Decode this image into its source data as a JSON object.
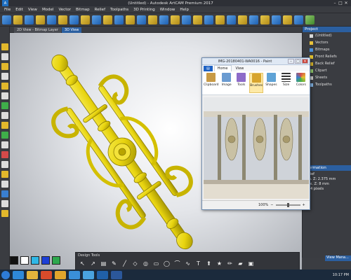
{
  "window": {
    "title": "(Untitled) - Autodesk ArtCAM Premium 2017",
    "logo": "A",
    "controls": [
      "–",
      "□",
      "✕"
    ]
  },
  "menu": [
    "File",
    "Edit",
    "View",
    "Model",
    "Vector",
    "Bitmap",
    "Relief",
    "Toolpaths",
    "3D Printing",
    "Window",
    "Help"
  ],
  "view_tabs": [
    "2D View - Bitmap Layer",
    "3D View"
  ],
  "project_panel": {
    "header": "Project",
    "items": [
      {
        "label": "(Untitled)",
        "color": "#d8d8d8"
      },
      {
        "label": "Vectors",
        "color": "#e8c23a"
      },
      {
        "label": "Bitmaps",
        "color": "#4a90d9"
      },
      {
        "label": "Front Reliefs",
        "color": "#e2c12e"
      },
      {
        "label": "Back Relief",
        "color": "#d6b22a"
      },
      {
        "label": "Clipart",
        "color": "#8fc46b"
      },
      {
        "label": "Sheets",
        "color": "#c9c9c9"
      },
      {
        "label": "Toolpaths",
        "color": "#7fb0e0"
      }
    ]
  },
  "information_panel": {
    "header": "Information",
    "lines": [
      "Relief",
      "Min. Z: 2.375 mm",
      "Max. Z: 8 mm",
      "...64 pixels"
    ]
  },
  "design_tools": {
    "header": "Design Tools",
    "icons": [
      "select-arrow",
      "node-edit",
      "eraser",
      "brush",
      "pencil",
      "transform",
      "fill",
      "rectangle",
      "ellipse",
      "polyline",
      "curve",
      "text",
      "dropper",
      "star",
      "paint",
      "eraser-2",
      "fill-2"
    ],
    "glyphs": [
      "↖",
      "↗",
      "▤",
      "✎",
      "╱",
      "◇",
      "◎",
      "▭",
      "◯",
      "⌒",
      "∿",
      "T",
      "⬆",
      "★",
      "✏",
      "▰",
      "▣"
    ]
  },
  "swatches": [
    "#111111",
    "#ffffff",
    "#2fb7e6",
    "#1c3fd6",
    "#2ea84e"
  ],
  "view_manager": "View Mana...",
  "taskbar": {
    "apps": [
      "start",
      "ie",
      "folder",
      "media",
      "chrome",
      "artcam",
      "paint",
      "ps",
      "word"
    ],
    "colors": [
      "#2d7bd6",
      "#2e88d8",
      "#e2b43c",
      "#d94b2b",
      "#e0a52c",
      "#3a8fd8",
      "#4aa3df",
      "#2060a8",
      "#2b579a"
    ],
    "clock": "10:17 PM"
  },
  "paint_window": {
    "title": "IMG-20180401-WA0016 - Paint",
    "controls": [
      "–",
      "□",
      "✕"
    ],
    "tabs": [
      "▤",
      "Home",
      "View"
    ],
    "ribbon": [
      {
        "label": "Clipboard",
        "color": "#c89a45"
      },
      {
        "label": "Image",
        "color": "#6a9bd1"
      },
      {
        "label": "Tools",
        "color": "#8d6bc9"
      },
      {
        "label": "Brushes",
        "color": "#d7a42d"
      },
      {
        "label": "Shapes",
        "color": "#5fa3d6"
      },
      {
        "label": "Size",
        "color": "#333333"
      },
      {
        "label": "Colors",
        "color": "#d44a4a"
      }
    ],
    "zoom": "100%"
  },
  "colors": {
    "ornament_gold": "#e8d40f",
    "ornament_shadow": "#9c8c00",
    "accent_blue": "#2b5fa0"
  }
}
